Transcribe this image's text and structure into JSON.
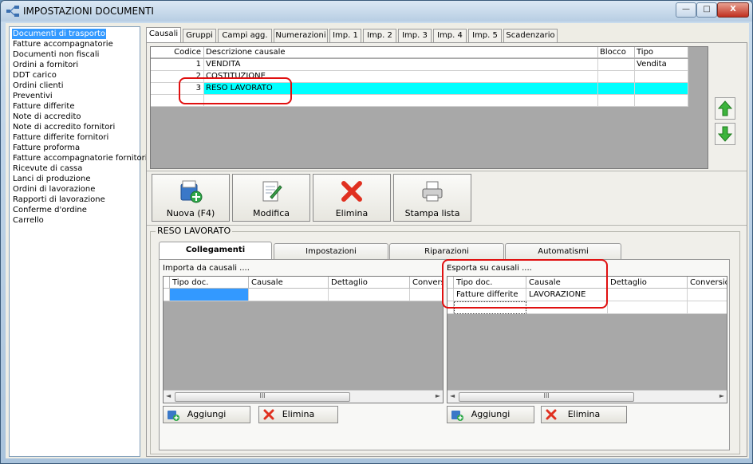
{
  "window": {
    "title": "IMPOSTAZIONI DOCUMENTI"
  },
  "window_buttons": {
    "minimize": "—",
    "maximize": "□",
    "close": "X"
  },
  "sidebar": {
    "items": [
      "Documenti di trasporto",
      "Fatture accompagnatorie",
      "Documenti non fiscali",
      "Ordini a fornitori",
      "DDT carico",
      "Ordini clienti",
      "Preventivi",
      "Fatture differite",
      "Note di accredito",
      "Note di accredito fornitori",
      "Fatture differite fornitori",
      "Fatture proforma",
      "Fatture accompagnatorie fornitori",
      "Ricevute di cassa",
      "Lanci di produzione",
      "Ordini di lavorazione",
      "Rapporti di lavorazione",
      "Conferme d'ordine",
      "Carrello"
    ],
    "selected_index": 0
  },
  "top_tabs": [
    "Causali",
    "Gruppi",
    "Campi agg.",
    "Numerazioni",
    "Imp. 1",
    "Imp. 2",
    "Imp. 3",
    "Imp. 4",
    "Imp. 5",
    "Scadenzario"
  ],
  "causali_table": {
    "headers": [
      "Codice",
      "Descrizione causale",
      "Blocco",
      "Tipo"
    ],
    "rows": [
      [
        "1",
        "VENDITA",
        "",
        "Vendita"
      ],
      [
        "2",
        "COSTITUZIONE",
        "",
        ""
      ],
      [
        "3",
        "RESO LAVORATO",
        "",
        ""
      ],
      [
        "",
        "",
        "",
        ""
      ]
    ],
    "selected_row": 2
  },
  "toolbar": {
    "new": "Nuova (F4)",
    "edit": "Modifica",
    "delete": "Elimina",
    "print": "Stampa lista"
  },
  "detail": {
    "title": "RESO LAVORATO",
    "tabs": [
      "Collegamenti",
      "Impostazioni",
      "Riparazioni",
      "Automatismi"
    ],
    "active_tab": 0,
    "import_label": "Importa da causali ....",
    "export_label": "Esporta su causali ....",
    "grid_headers": [
      "Tipo doc.",
      "Causale",
      "Dettaglio",
      "Conversione"
    ],
    "import_rows": [
      [
        "",
        "",
        "",
        ""
      ]
    ],
    "export_rows": [
      [
        "Fatture differite",
        "LAVORAZIONE",
        "",
        ""
      ]
    ],
    "add_button": "Aggiungi",
    "delete_button": "Elimina",
    "scroll_thumb_glyph": "III"
  },
  "colors": {
    "selection": "#3399ff",
    "row_highlight": "#00ffff",
    "annotation": "#e01010",
    "arrow_green": "#3cb43c"
  }
}
